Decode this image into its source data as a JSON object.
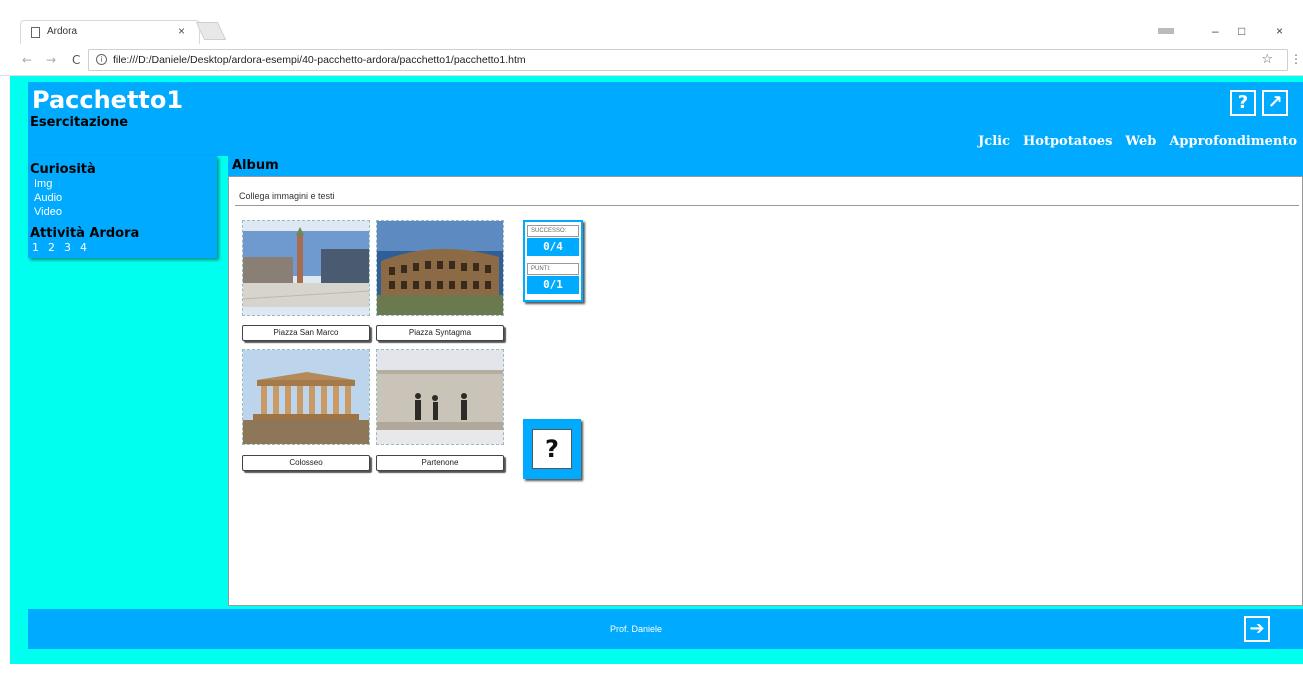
{
  "browser": {
    "tab_title": "Ardora",
    "tab_close": "×",
    "url": "file:///D:/Daniele/Desktop/ardora-esempi/40-pacchetto-ardora/pacchetto1/pacchetto1.htm",
    "nav_back": "←",
    "nav_forward": "→",
    "nav_reload": "C",
    "star": "☆",
    "menu": "⋮",
    "win_min": "–",
    "win_max": "□",
    "win_close": "×"
  },
  "header": {
    "title": "Pacchetto1",
    "subtitle": "Esercitazione",
    "help_label": "?",
    "external_label": "↗",
    "menu": [
      "Jclic",
      "Hotpotatoes",
      "Web",
      "Approfondimento"
    ]
  },
  "sidebar": {
    "section1_title": "Curiosità",
    "items": [
      "Img",
      "Audio",
      "Video"
    ],
    "section2_title": "Attività Ardora",
    "activities": [
      "1",
      "2",
      "3",
      "4"
    ]
  },
  "main": {
    "section_title": "Album",
    "instruction": "Collega immagini e testi",
    "labels": [
      "Piazza San Marco",
      "Piazza Syntagma",
      "Colosseo",
      "Partenone"
    ],
    "images": [
      "venice-piazza-photo",
      "colosseum-photo",
      "parthenon-photo",
      "syntagma-guards-photo"
    ],
    "score": {
      "success_label": "SUCCESSO:",
      "success_value": "0/4",
      "points_label": "PUNTI:",
      "points_value": "0/1"
    },
    "check_label": "?"
  },
  "footer": {
    "author": "Prof. Daniele",
    "next_label": "➔"
  },
  "colors": {
    "accent_blue": "#00aaff",
    "cyan_bg": "#00ffee"
  }
}
